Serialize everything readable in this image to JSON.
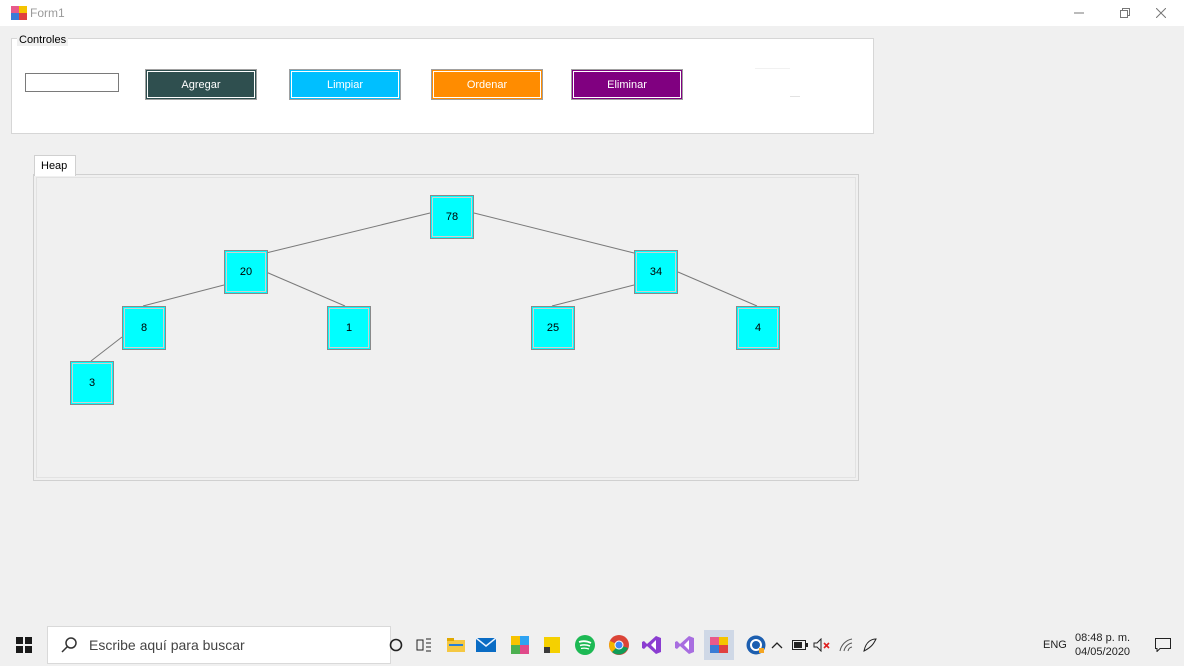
{
  "window": {
    "title": "Form1"
  },
  "controls_group": {
    "label": "Controles",
    "value_input": "",
    "buttons": {
      "agregar": "Agregar",
      "limpiar": "Limpiar",
      "ordenar": "Ordenar",
      "eliminar": "Eliminar"
    },
    "button_colors": {
      "agregar": "#2f4f4f",
      "limpiar": "#00bfff",
      "ordenar": "#ff8c00",
      "eliminar": "#800080"
    }
  },
  "tabs": [
    {
      "label": "Heap"
    }
  ],
  "heap": {
    "node_color": "#00ffff",
    "nodes": [
      "78",
      "20",
      "34",
      "8",
      "1",
      "25",
      "4",
      "3"
    ]
  },
  "taskbar": {
    "search_placeholder": "Escribe aquí para buscar",
    "language": "ENG",
    "time": "08:48 p. m.",
    "date": "04/05/2020",
    "pinned_icons": [
      "cortana-icon",
      "task-view-icon",
      "file-explorer-icon",
      "mail-icon",
      "paint-icon",
      "sticky-notes-icon",
      "spotify-icon",
      "chrome-icon",
      "vs-code-icon",
      "visual-studio-icon",
      "form-app-icon"
    ],
    "tray_icons": [
      "help-icon",
      "chevron-up-icon",
      "battery-icon",
      "volume-muted-icon",
      "wifi-icon",
      "pen-icon",
      "notifications-icon"
    ]
  }
}
